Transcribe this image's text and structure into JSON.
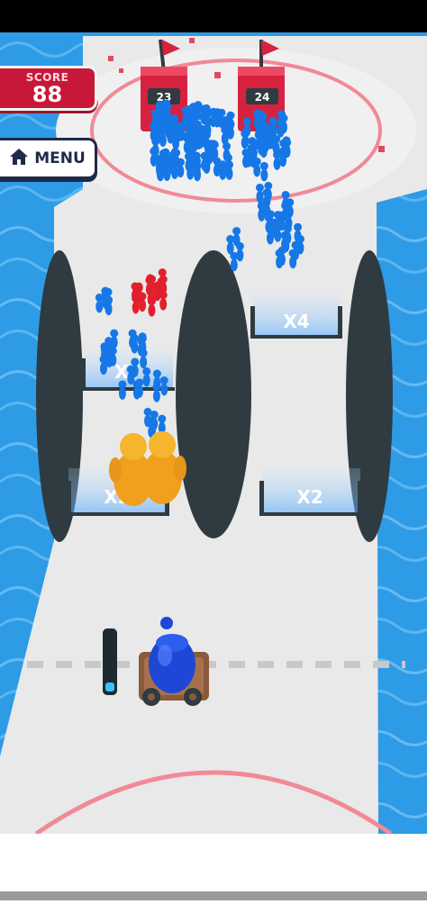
{
  "hud": {
    "score_label": "SCORE",
    "score_value": "88",
    "menu_label": "MENU",
    "menu_icon": "home-icon"
  },
  "towers": [
    {
      "label": "23",
      "color": "#d6223f"
    },
    {
      "label": "24",
      "color": "#d6223f"
    }
  ],
  "gates": [
    {
      "label": "X4"
    },
    {
      "label": "X2"
    },
    {
      "label": "X2"
    },
    {
      "label": "X"
    }
  ],
  "colors": {
    "water": "#2e9be6",
    "track": "#ececec",
    "ring": "#f08a96",
    "blue_crowd": "#1677e6",
    "red_crowd": "#e0202c",
    "giant": "#f5a623",
    "cannon": "#1f47d6",
    "obstacle": "#2f3b40"
  }
}
